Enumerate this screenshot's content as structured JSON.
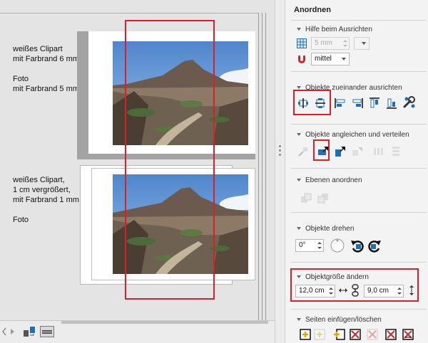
{
  "canvas": {
    "notes": {
      "top": "weißes Clipart\nmit Farbrand 6 mm\n\nFoto\nmit Farbrand 5 mm",
      "bottom": "weißes Clipart,\n1 cm vergrößert,\nmit Farbrand 1 mm\n\nFoto"
    }
  },
  "panel": {
    "title": "Anordnen",
    "sections": {
      "help": {
        "title": "Hilfe beim Ausrichten",
        "grid_value": "5 mm",
        "snap_value": "mittel"
      },
      "align": {
        "title": "Objekte zueinander ausrichten"
      },
      "distribute": {
        "title": "Objekte angleichen und verteilen"
      },
      "layers": {
        "title": "Ebenen anordnen"
      },
      "rotate": {
        "title": "Objekte drehen",
        "angle": "0°"
      },
      "size": {
        "title": "Objektgröße ändern",
        "width": "12,0 cm",
        "height": "9,0 cm"
      },
      "pages": {
        "title": "Seiten einfügen/löschen"
      }
    }
  },
  "colors": {
    "highlight": "#d8202a",
    "accent": "#1f6fb5"
  }
}
